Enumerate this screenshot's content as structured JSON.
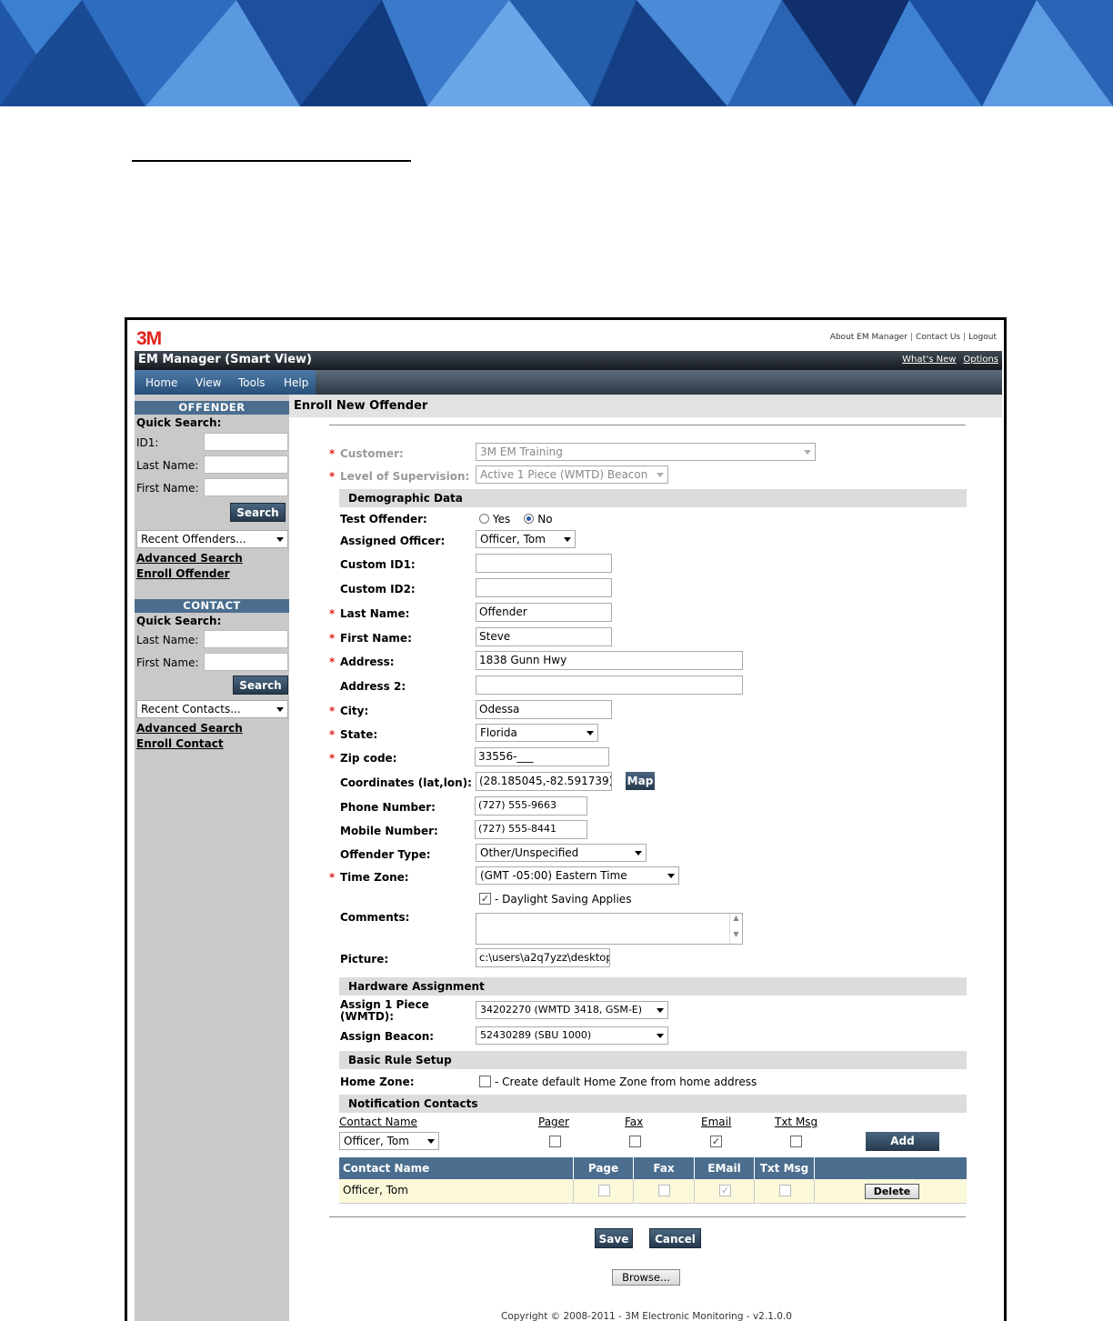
{
  "page": {
    "top_links": [
      "About EM Manager",
      "Contact Us",
      "Logout"
    ],
    "logo": "3M",
    "app_title": "EM Manager (Smart View)",
    "title_links": [
      "What's New",
      "Options"
    ],
    "menu": [
      "Home",
      "View",
      "Tools",
      "Help"
    ]
  },
  "sidebar": {
    "offender": {
      "header": "OFFENDER",
      "quick_search": "Quick Search:",
      "id1_label": "ID1:",
      "last_name_label": "Last Name:",
      "first_name_label": "First Name:",
      "search_button": "Search",
      "recent_select": "Recent Offenders...",
      "advanced_search": "Advanced Search",
      "enroll_link": "Enroll Offender"
    },
    "contact": {
      "header": "CONTACT",
      "quick_search": "Quick Search:",
      "last_name_label": "Last Name:",
      "first_name_label": "First Name:",
      "search_button": "Search",
      "recent_select": "Recent Contacts...",
      "advanced_search": "Advanced Search",
      "enroll_link": "Enroll Contact"
    }
  },
  "form": {
    "title": "Enroll New Offender",
    "customer": {
      "label": "Customer:",
      "value": "3M EM Training"
    },
    "supervision": {
      "label": "Level of Supervision:",
      "value": "Active 1 Piece (WMTD) Beacon"
    },
    "demographic_header": "Demographic Data",
    "test_offender": {
      "label": "Test Offender:",
      "yes": "Yes",
      "no": "No",
      "selected": "No"
    },
    "assigned_officer": {
      "label": "Assigned Officer:",
      "value": "Officer, Tom"
    },
    "custom_id1": {
      "label": "Custom ID1:",
      "value": ""
    },
    "custom_id2": {
      "label": "Custom ID2:",
      "value": ""
    },
    "last_name": {
      "label": "Last Name:",
      "value": "Offender"
    },
    "first_name": {
      "label": "First Name:",
      "value": "Steve"
    },
    "address": {
      "label": "Address:",
      "value": "1838 Gunn Hwy"
    },
    "address2": {
      "label": "Address 2:",
      "value": ""
    },
    "city": {
      "label": "City:",
      "value": "Odessa"
    },
    "state": {
      "label": "State:",
      "value": "Florida"
    },
    "zip": {
      "label": "Zip code:",
      "value": "33556-___"
    },
    "coordinates": {
      "label": "Coordinates (lat,lon):",
      "value": "(28.185045,-82.591739)",
      "button": "Map"
    },
    "phone": {
      "label": "Phone Number:",
      "value": "(727) 555-9663"
    },
    "mobile": {
      "label": "Mobile Number:",
      "value": "(727) 555-8441"
    },
    "offender_type": {
      "label": "Offender Type:",
      "value": "Other/Unspecified"
    },
    "time_zone": {
      "label": "Time Zone:",
      "value": "(GMT -05:00) Eastern Time"
    },
    "daylight": {
      "label": "- Daylight Saving Applies",
      "checked": true
    },
    "comments": {
      "label": "Comments:",
      "value": ""
    },
    "picture": {
      "label": "Picture:",
      "value": "c:\\users\\a2q7yzz\\desktop",
      "button": "Browse..."
    },
    "hardware_header": "Hardware Assignment",
    "assign_wmtd": {
      "label_line1": "Assign 1 Piece",
      "label_line2": "(WMTD):",
      "value": "34202270 (WMTD 3418, GSM-E)"
    },
    "assign_beacon": {
      "label": "Assign Beacon:",
      "value": "52430289 (SBU 1000)"
    },
    "rule_header": "Basic Rule Setup",
    "home_zone": {
      "label": "Home Zone:",
      "option": "- Create default Home Zone from home address",
      "checked": false
    },
    "notification_header": "Notification Contacts",
    "nc_columns": [
      "Contact Name",
      "Pager",
      "Fax",
      "Email",
      "Txt Msg"
    ],
    "nc_contact_select": "Officer, Tom",
    "nc_checks": {
      "pager": false,
      "fax": false,
      "email": true,
      "txt": false
    },
    "add_button": "Add",
    "table": {
      "headers": [
        "Contact Name",
        "Page",
        "Fax",
        "EMail",
        "Txt Msg"
      ],
      "rows": [
        {
          "name": "Officer, Tom",
          "page": false,
          "fax": false,
          "email": true,
          "txt": false,
          "action": "Delete"
        }
      ]
    },
    "save_button": "Save",
    "cancel_button": "Cancel"
  },
  "footer": "Copyright © 2008-2011 - 3M Electronic Monitoring - v2.1.0.0",
  "colors": {
    "accent": "#4b6e8f",
    "brand": "#e2231a",
    "required": "#d22222",
    "row_highlight": "#fbf9d9"
  }
}
